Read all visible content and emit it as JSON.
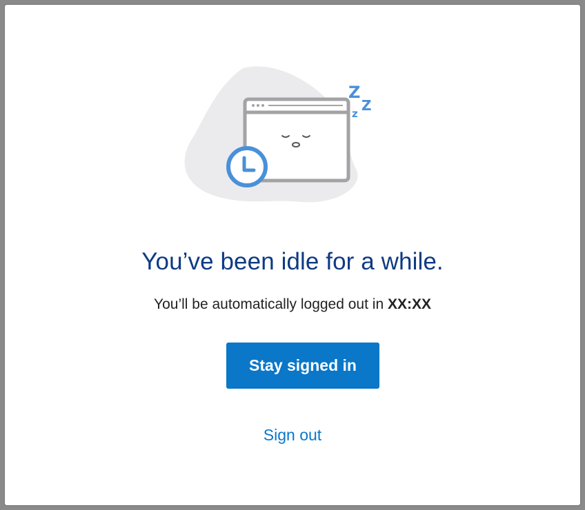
{
  "dialog": {
    "title": "You’ve been idle for a while.",
    "message_prefix": "You’ll be automatically logged out in ",
    "countdown": "XX:XX",
    "primary_button": "Stay signed in",
    "secondary_link": "Sign out"
  },
  "illustration": {
    "icons": [
      "sleeping-browser-window-icon",
      "clock-icon",
      "zzz-icon"
    ],
    "zzz_text": [
      "Z",
      "Z",
      "z"
    ]
  },
  "colors": {
    "title": "#0e3a84",
    "accent": "#0a77c9",
    "blob": "#ebebed",
    "window_stroke": "#a3a3a6",
    "clock": "#4a90d9"
  }
}
